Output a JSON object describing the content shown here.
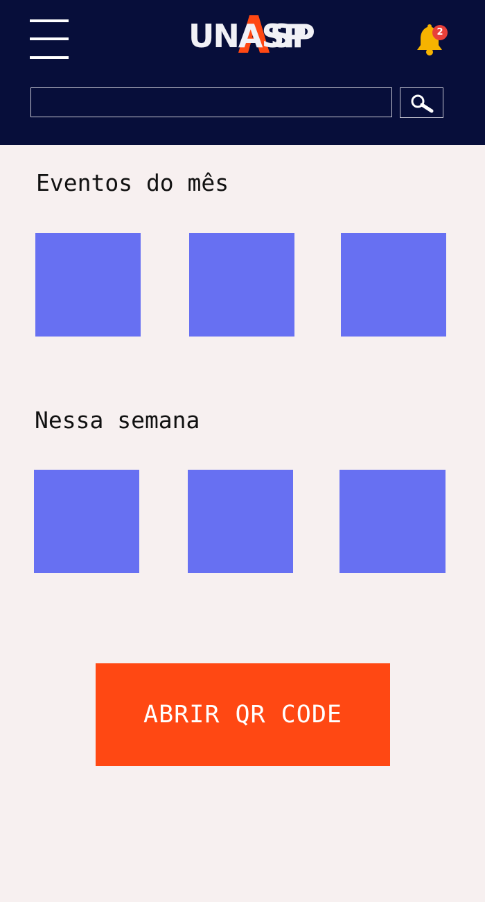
{
  "header": {
    "logo_text": "UNASP",
    "notifications": {
      "count": "2"
    },
    "search": {
      "value": "",
      "placeholder": ""
    }
  },
  "sections": [
    {
      "title": "Eventos do mês",
      "cards": 3
    },
    {
      "title": "Nessa semana",
      "cards": 3
    }
  ],
  "qr_button": {
    "label": "ABRIR QR CODE"
  },
  "colors": {
    "header_bg": "#070e3a",
    "page_bg": "#f7f0f0",
    "card": "#6770f2",
    "accent": "#ff4813",
    "bell": "#f6b300",
    "badge": "#e8403a"
  },
  "icons": {
    "menu": "menu-icon",
    "notifications": "bell-icon",
    "search": "search-icon"
  }
}
